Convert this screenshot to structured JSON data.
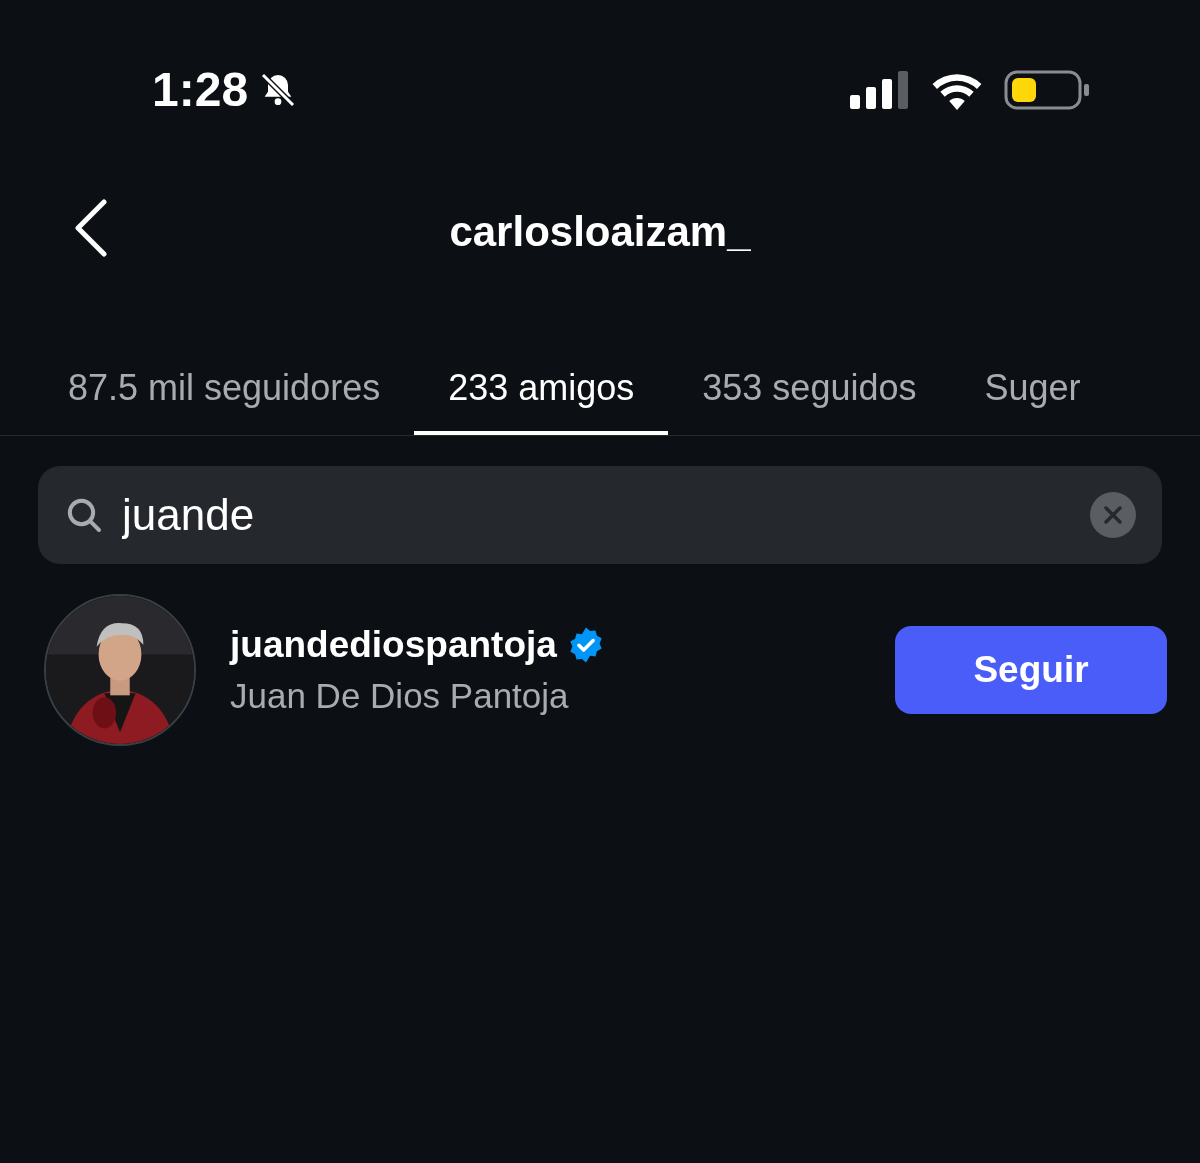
{
  "status_bar": {
    "time": "1:28"
  },
  "header": {
    "title": "carlosloaizam_"
  },
  "tabs": [
    {
      "label": "87.5 mil seguidores",
      "selected": false
    },
    {
      "label": "233 amigos",
      "selected": true
    },
    {
      "label": "353 seguidos",
      "selected": false
    },
    {
      "label": "Suger",
      "selected": false
    }
  ],
  "search": {
    "value": "juande"
  },
  "results": [
    {
      "username": "juandediospantoja",
      "verified": true,
      "full_name": "Juan De Dios Pantoja",
      "button": "Seguir"
    }
  ]
}
